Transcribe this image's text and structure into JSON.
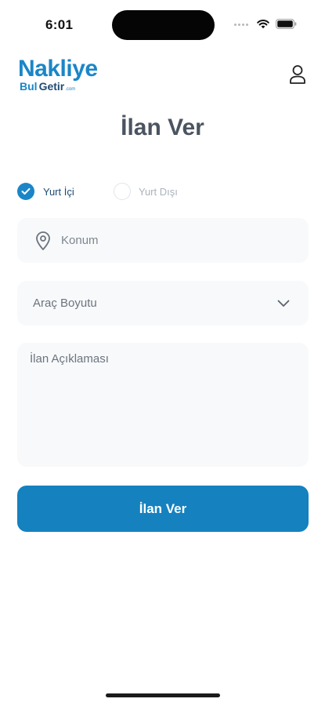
{
  "status_bar": {
    "time": "6:01"
  },
  "header": {
    "logo": {
      "top": "Nakliye",
      "bottom_left": "Bul",
      "bottom_right": "Getir",
      "suffix": ".com"
    },
    "profile_icon": "user-icon"
  },
  "page": {
    "title": "İlan Ver"
  },
  "trip_type": {
    "options": [
      {
        "label": "Yurt İçi",
        "selected": true
      },
      {
        "label": "Yurt Dışı",
        "selected": false
      }
    ]
  },
  "form": {
    "location": {
      "placeholder": "Konum",
      "value": ""
    },
    "vehicle_size": {
      "placeholder": "Araç Boyutu"
    },
    "description": {
      "placeholder": "İlan Açıklaması",
      "value": ""
    },
    "submit_label": "İlan Ver"
  },
  "colors": {
    "accent": "#1a86c7",
    "button": "#1581bf",
    "field_bg": "#f8f9fa",
    "title_text": "#4b5461"
  }
}
